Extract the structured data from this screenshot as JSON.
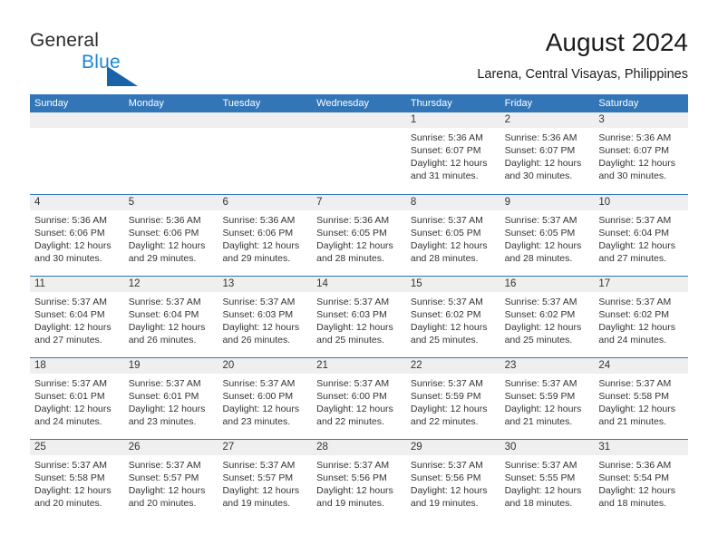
{
  "brand": {
    "name_part1": "General",
    "name_part2": "Blue",
    "accent_color": "#1964a8",
    "blue_text_color": "#1a86d8"
  },
  "header": {
    "title": "August 2024",
    "subtitle": "Larena, Central Visayas, Philippines",
    "header_bg_color": "#3276b8"
  },
  "weekdays": [
    "Sunday",
    "Monday",
    "Tuesday",
    "Wednesday",
    "Thursday",
    "Friday",
    "Saturday"
  ],
  "labels": {
    "sunrise_prefix": "Sunrise:",
    "sunset_prefix": "Sunset:",
    "daylight_prefix": "Daylight:"
  },
  "weeks": [
    [
      {
        "day": "",
        "sunrise": "",
        "sunset": "",
        "daylight_line1": "",
        "daylight_line2": ""
      },
      {
        "day": "",
        "sunrise": "",
        "sunset": "",
        "daylight_line1": "",
        "daylight_line2": ""
      },
      {
        "day": "",
        "sunrise": "",
        "sunset": "",
        "daylight_line1": "",
        "daylight_line2": ""
      },
      {
        "day": "",
        "sunrise": "",
        "sunset": "",
        "daylight_line1": "",
        "daylight_line2": ""
      },
      {
        "day": "1",
        "sunrise": "Sunrise: 5:36 AM",
        "sunset": "Sunset: 6:07 PM",
        "daylight_line1": "Daylight: 12 hours",
        "daylight_line2": "and 31 minutes."
      },
      {
        "day": "2",
        "sunrise": "Sunrise: 5:36 AM",
        "sunset": "Sunset: 6:07 PM",
        "daylight_line1": "Daylight: 12 hours",
        "daylight_line2": "and 30 minutes."
      },
      {
        "day": "3",
        "sunrise": "Sunrise: 5:36 AM",
        "sunset": "Sunset: 6:07 PM",
        "daylight_line1": "Daylight: 12 hours",
        "daylight_line2": "and 30 minutes."
      }
    ],
    [
      {
        "day": "4",
        "sunrise": "Sunrise: 5:36 AM",
        "sunset": "Sunset: 6:06 PM",
        "daylight_line1": "Daylight: 12 hours",
        "daylight_line2": "and 30 minutes."
      },
      {
        "day": "5",
        "sunrise": "Sunrise: 5:36 AM",
        "sunset": "Sunset: 6:06 PM",
        "daylight_line1": "Daylight: 12 hours",
        "daylight_line2": "and 29 minutes."
      },
      {
        "day": "6",
        "sunrise": "Sunrise: 5:36 AM",
        "sunset": "Sunset: 6:06 PM",
        "daylight_line1": "Daylight: 12 hours",
        "daylight_line2": "and 29 minutes."
      },
      {
        "day": "7",
        "sunrise": "Sunrise: 5:36 AM",
        "sunset": "Sunset: 6:05 PM",
        "daylight_line1": "Daylight: 12 hours",
        "daylight_line2": "and 28 minutes."
      },
      {
        "day": "8",
        "sunrise": "Sunrise: 5:37 AM",
        "sunset": "Sunset: 6:05 PM",
        "daylight_line1": "Daylight: 12 hours",
        "daylight_line2": "and 28 minutes."
      },
      {
        "day": "9",
        "sunrise": "Sunrise: 5:37 AM",
        "sunset": "Sunset: 6:05 PM",
        "daylight_line1": "Daylight: 12 hours",
        "daylight_line2": "and 28 minutes."
      },
      {
        "day": "10",
        "sunrise": "Sunrise: 5:37 AM",
        "sunset": "Sunset: 6:04 PM",
        "daylight_line1": "Daylight: 12 hours",
        "daylight_line2": "and 27 minutes."
      }
    ],
    [
      {
        "day": "11",
        "sunrise": "Sunrise: 5:37 AM",
        "sunset": "Sunset: 6:04 PM",
        "daylight_line1": "Daylight: 12 hours",
        "daylight_line2": "and 27 minutes."
      },
      {
        "day": "12",
        "sunrise": "Sunrise: 5:37 AM",
        "sunset": "Sunset: 6:04 PM",
        "daylight_line1": "Daylight: 12 hours",
        "daylight_line2": "and 26 minutes."
      },
      {
        "day": "13",
        "sunrise": "Sunrise: 5:37 AM",
        "sunset": "Sunset: 6:03 PM",
        "daylight_line1": "Daylight: 12 hours",
        "daylight_line2": "and 26 minutes."
      },
      {
        "day": "14",
        "sunrise": "Sunrise: 5:37 AM",
        "sunset": "Sunset: 6:03 PM",
        "daylight_line1": "Daylight: 12 hours",
        "daylight_line2": "and 25 minutes."
      },
      {
        "day": "15",
        "sunrise": "Sunrise: 5:37 AM",
        "sunset": "Sunset: 6:02 PM",
        "daylight_line1": "Daylight: 12 hours",
        "daylight_line2": "and 25 minutes."
      },
      {
        "day": "16",
        "sunrise": "Sunrise: 5:37 AM",
        "sunset": "Sunset: 6:02 PM",
        "daylight_line1": "Daylight: 12 hours",
        "daylight_line2": "and 25 minutes."
      },
      {
        "day": "17",
        "sunrise": "Sunrise: 5:37 AM",
        "sunset": "Sunset: 6:02 PM",
        "daylight_line1": "Daylight: 12 hours",
        "daylight_line2": "and 24 minutes."
      }
    ],
    [
      {
        "day": "18",
        "sunrise": "Sunrise: 5:37 AM",
        "sunset": "Sunset: 6:01 PM",
        "daylight_line1": "Daylight: 12 hours",
        "daylight_line2": "and 24 minutes."
      },
      {
        "day": "19",
        "sunrise": "Sunrise: 5:37 AM",
        "sunset": "Sunset: 6:01 PM",
        "daylight_line1": "Daylight: 12 hours",
        "daylight_line2": "and 23 minutes."
      },
      {
        "day": "20",
        "sunrise": "Sunrise: 5:37 AM",
        "sunset": "Sunset: 6:00 PM",
        "daylight_line1": "Daylight: 12 hours",
        "daylight_line2": "and 23 minutes."
      },
      {
        "day": "21",
        "sunrise": "Sunrise: 5:37 AM",
        "sunset": "Sunset: 6:00 PM",
        "daylight_line1": "Daylight: 12 hours",
        "daylight_line2": "and 22 minutes."
      },
      {
        "day": "22",
        "sunrise": "Sunrise: 5:37 AM",
        "sunset": "Sunset: 5:59 PM",
        "daylight_line1": "Daylight: 12 hours",
        "daylight_line2": "and 22 minutes."
      },
      {
        "day": "23",
        "sunrise": "Sunrise: 5:37 AM",
        "sunset": "Sunset: 5:59 PM",
        "daylight_line1": "Daylight: 12 hours",
        "daylight_line2": "and 21 minutes."
      },
      {
        "day": "24",
        "sunrise": "Sunrise: 5:37 AM",
        "sunset": "Sunset: 5:58 PM",
        "daylight_line1": "Daylight: 12 hours",
        "daylight_line2": "and 21 minutes."
      }
    ],
    [
      {
        "day": "25",
        "sunrise": "Sunrise: 5:37 AM",
        "sunset": "Sunset: 5:58 PM",
        "daylight_line1": "Daylight: 12 hours",
        "daylight_line2": "and 20 minutes."
      },
      {
        "day": "26",
        "sunrise": "Sunrise: 5:37 AM",
        "sunset": "Sunset: 5:57 PM",
        "daylight_line1": "Daylight: 12 hours",
        "daylight_line2": "and 20 minutes."
      },
      {
        "day": "27",
        "sunrise": "Sunrise: 5:37 AM",
        "sunset": "Sunset: 5:57 PM",
        "daylight_line1": "Daylight: 12 hours",
        "daylight_line2": "and 19 minutes."
      },
      {
        "day": "28",
        "sunrise": "Sunrise: 5:37 AM",
        "sunset": "Sunset: 5:56 PM",
        "daylight_line1": "Daylight: 12 hours",
        "daylight_line2": "and 19 minutes."
      },
      {
        "day": "29",
        "sunrise": "Sunrise: 5:37 AM",
        "sunset": "Sunset: 5:56 PM",
        "daylight_line1": "Daylight: 12 hours",
        "daylight_line2": "and 19 minutes."
      },
      {
        "day": "30",
        "sunrise": "Sunrise: 5:37 AM",
        "sunset": "Sunset: 5:55 PM",
        "daylight_line1": "Daylight: 12 hours",
        "daylight_line2": "and 18 minutes."
      },
      {
        "day": "31",
        "sunrise": "Sunrise: 5:36 AM",
        "sunset": "Sunset: 5:54 PM",
        "daylight_line1": "Daylight: 12 hours",
        "daylight_line2": "and 18 minutes."
      }
    ]
  ]
}
